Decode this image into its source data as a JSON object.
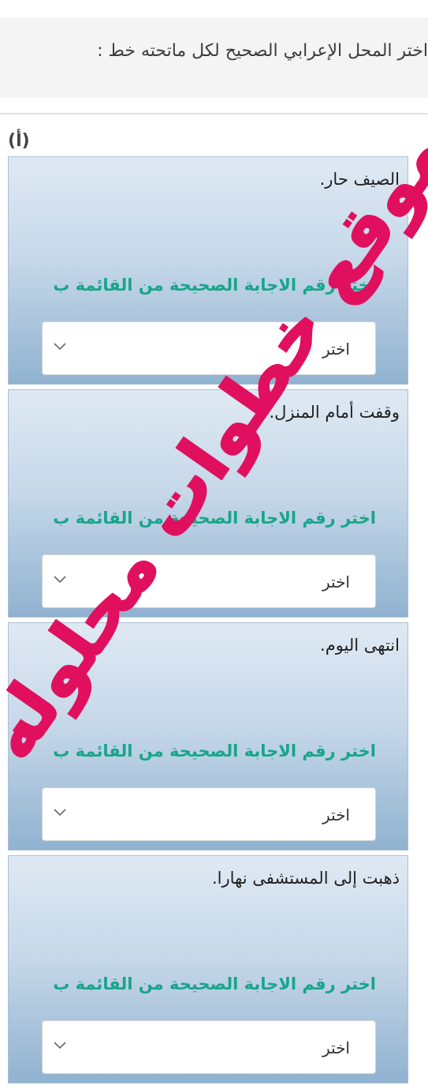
{
  "instruction": "اختر المحل الإعرابي الصحيح لكل ماتحته خط :",
  "part_label": "(أ)",
  "questions": [
    {
      "text": "الصيف حار.",
      "prompt": "اختر رقم الاجابة الصحيحة من القائمة ب",
      "select_value": "اختر"
    },
    {
      "text": "وقفت أمام المنزل.",
      "prompt": "اختر رقم الاجابة الصحيحة من القائمة ب",
      "select_value": "اختر"
    },
    {
      "text": "انتهى اليوم.",
      "prompt": "اختر رقم الاجابة الصحيحة من القائمة ب",
      "select_value": "اختر"
    },
    {
      "text": "ذهبت إلى المستشفى نهارا.",
      "prompt": "اختر رقم الاجابة الصحيحة من القائمة ب",
      "select_value": "اختر"
    }
  ],
  "watermark": {
    "text": "موقع خطوات محلوله",
    "color": "#e0105f"
  },
  "colors": {
    "prompt": "#18a58a",
    "card_top": "#dfe9f3",
    "card_bottom": "#90b2d0"
  },
  "icons": {
    "select_arrow": "chevron-down-icon"
  }
}
